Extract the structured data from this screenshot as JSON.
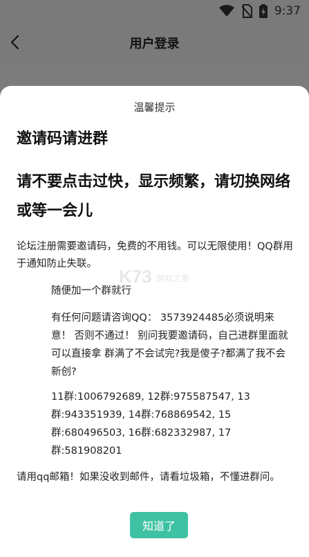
{
  "status_bar": {
    "time": "9:37",
    "icons": [
      "wifi-icon",
      "no-sim-icon",
      "battery-charging-icon"
    ]
  },
  "app_bar": {
    "back_icon": "chevron-left-icon",
    "title": "用户登录"
  },
  "dialog": {
    "caption": "温馨提示",
    "heading": "邀请码请进群",
    "warning": "请不要点击过快，显示频繁，请切换网络或等一会儿",
    "paragraphs": {
      "intro": "论坛注册需要邀请码，免费的不用钱。可以无限使用！QQ群用于通知防止失联。",
      "join_any": "随便加一个群就行",
      "contact": "有任何问题请咨询QQ： 3573924485必须说明来意！ 否则不通过！ 别问我要邀请码，自己进群里面就可以直接拿 群满了不会试完?我是傻子?都满了我不会新创?",
      "groups": "11群:1006792689, 12群:975587547, 13群:943351939, 14群:768869542, 15群:680496503, 16群:682332987, 17群:581908201",
      "email": "请用qq邮箱！如果没收到邮件，请看垃圾箱，不懂进群问。"
    },
    "confirm_label": "知道了"
  },
  "watermark": {
    "logo_text": "K73",
    "sub_text": "游戏之家"
  },
  "colors": {
    "accent": "#3fc2a3",
    "overlay": "#7c7c7c"
  }
}
